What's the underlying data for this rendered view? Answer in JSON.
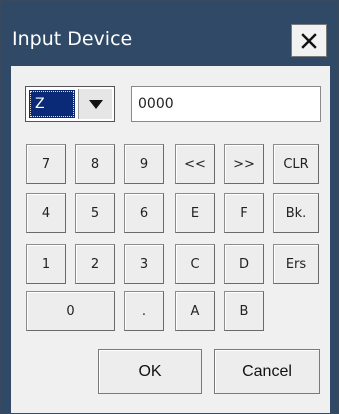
{
  "window": {
    "title": "Input Device",
    "close_icon": "close-icon"
  },
  "colors": {
    "titlebar": "#2f4967",
    "selected": "#0a2a78"
  },
  "device_select": {
    "selected": "Z",
    "dropdown_icon": "chevron-down-icon"
  },
  "value_field": {
    "value": "0000"
  },
  "keypad": {
    "rows": [
      [
        "7",
        "8",
        "9",
        "<<",
        ">>",
        "CLR"
      ],
      [
        "4",
        "5",
        "6",
        "E",
        "F",
        "Bk."
      ],
      [
        "1",
        "2",
        "3",
        "C",
        "D",
        "Ers"
      ],
      [
        "0",
        ".",
        "A",
        "B"
      ]
    ]
  },
  "buttons": {
    "ok": "OK",
    "cancel": "Cancel"
  }
}
